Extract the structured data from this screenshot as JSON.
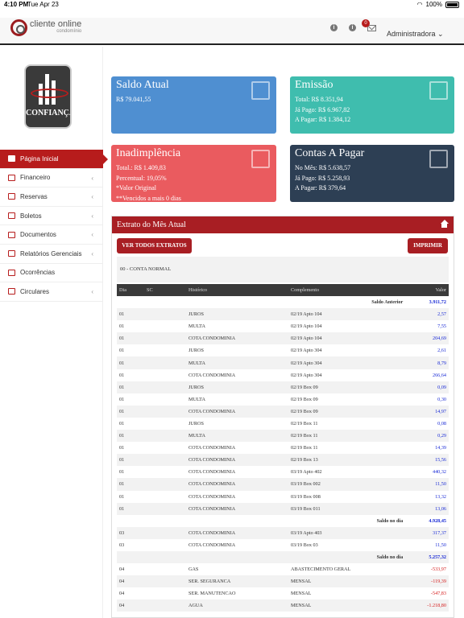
{
  "status": {
    "time": "4:10 PM",
    "date": "Tue Apr 23",
    "battery": "100%"
  },
  "header": {
    "logo_main": "cliente online",
    "logo_sub": "condomínio",
    "notif_count": "0",
    "user": "Administradora ⌄"
  },
  "brand": {
    "name": "CONFIANÇA"
  },
  "nav": [
    {
      "label": "Página Inicial",
      "active": true,
      "chev": ""
    },
    {
      "label": "Financeiro",
      "chev": "‹"
    },
    {
      "label": "Reservas",
      "chev": "‹"
    },
    {
      "label": "Boletos",
      "chev": "‹"
    },
    {
      "label": "Documentos",
      "chev": "‹"
    },
    {
      "label": "Relatórios Gerenciais",
      "chev": "‹"
    },
    {
      "label": "Ocorrências",
      "chev": ""
    },
    {
      "label": "Circulares",
      "chev": "‹"
    }
  ],
  "cards": {
    "saldo": {
      "title": "Saldo Atual",
      "lines": [
        "R$ 79.041,55"
      ],
      "color": "#4f8fd1"
    },
    "emissao": {
      "title": "Emissão",
      "lines": [
        "Total: R$ 8.351,94",
        "Já Pago: R$ 6.967,82",
        "A Pagar: R$ 1.384,12"
      ],
      "color": "#3fbdae"
    },
    "inad": {
      "title": "Inadimplência",
      "lines": [
        "Total.: R$ 1.409,83",
        "Percentual: 19,05%",
        "*Valor Original",
        "**Vencidos a mais 0 dias"
      ],
      "color": "#ea5b5f"
    },
    "contas": {
      "title": "Contas A Pagar",
      "lines": [
        "No Mês: R$ 5.638,57",
        "Já Pago: R$ 5.258,93",
        "A Pagar: R$ 379,64"
      ],
      "color": "#2d3f54"
    }
  },
  "extrato": {
    "title": "Extrato do Mês Atual",
    "btn_all": "VER TODOS EXTRATOS",
    "btn_print": "IMPRIMIR",
    "account": "00 - CONTA NORMAL",
    "columns": [
      "Dia",
      "SC",
      "Histórico",
      "Complemento",
      "Valor"
    ],
    "rows": [
      {
        "sum": true,
        "label": "Saldo Anterior",
        "v": "3.911,72"
      },
      {
        "d": "01",
        "h": "JUROS",
        "c": "02/19 Apto 104",
        "v": "2,57"
      },
      {
        "d": "01",
        "h": "MULTA",
        "c": "02/19 Apto 104",
        "v": "7,55"
      },
      {
        "d": "01",
        "h": "COTA CONDOMINIA",
        "c": "02/19 Apto 104",
        "v": "204,69"
      },
      {
        "d": "01",
        "h": "JUROS",
        "c": "02/19 Apto 304",
        "v": "2,61"
      },
      {
        "d": "01",
        "h": "MULTA",
        "c": "02/19 Apto 304",
        "v": "8,79"
      },
      {
        "d": "01",
        "h": "COTA CONDOMINIA",
        "c": "02/19 Apto 304",
        "v": "266,64"
      },
      {
        "d": "01",
        "h": "JUROS",
        "c": "02/19 Box 09",
        "v": "0,09"
      },
      {
        "d": "01",
        "h": "MULTA",
        "c": "02/19 Box 09",
        "v": "0,30"
      },
      {
        "d": "01",
        "h": "COTA CONDOMINIA",
        "c": "02/19 Box 09",
        "v": "14,97"
      },
      {
        "d": "01",
        "h": "JUROS",
        "c": "02/19 Box 11",
        "v": "0,08"
      },
      {
        "d": "01",
        "h": "MULTA",
        "c": "02/19 Box 11",
        "v": "0,29"
      },
      {
        "d": "01",
        "h": "COTA CONDOMINIA",
        "c": "02/19 Box 11",
        "v": "14,39"
      },
      {
        "d": "01",
        "h": "COTA CONDOMINIA",
        "c": "02/19 Box 13",
        "v": "15,56"
      },
      {
        "d": "01",
        "h": "COTA CONDOMINIA",
        "c": "03/19 Apto 402",
        "v": "440,32"
      },
      {
        "d": "01",
        "h": "COTA CONDOMINIA",
        "c": "03/19 Box 002",
        "v": "11,50"
      },
      {
        "d": "01",
        "h": "COTA CONDOMINIA",
        "c": "03/19 Box 008",
        "v": "13,32"
      },
      {
        "d": "01",
        "h": "COTA CONDOMINIA",
        "c": "03/19 Box 011",
        "v": "13,06"
      },
      {
        "sum": true,
        "label": "Saldo no dia",
        "v": "4.928,45"
      },
      {
        "d": "03",
        "h": "COTA CONDOMINIA",
        "c": "03/19 Apto 403",
        "v": "317,37"
      },
      {
        "d": "03",
        "h": "COTA CONDOMINIA",
        "c": "03/19 Box 03",
        "v": "11,50"
      },
      {
        "sum": true,
        "label": "Saldo no dia",
        "v": "5.257,32"
      },
      {
        "d": "04",
        "h": "GAS",
        "c": "ABASTECIMENTO GERAL",
        "v": "-533,97",
        "neg": true
      },
      {
        "d": "04",
        "h": "SER. SEGURANCA",
        "c": "MENSAL",
        "v": "-119,39",
        "neg": true
      },
      {
        "d": "04",
        "h": "SER. MANUTENCAO",
        "c": "MENSAL",
        "v": "-547,83",
        "neg": true
      },
      {
        "d": "04",
        "h": "AGUA",
        "c": "MENSAL",
        "v": "-1.218,80",
        "neg": true
      }
    ]
  }
}
